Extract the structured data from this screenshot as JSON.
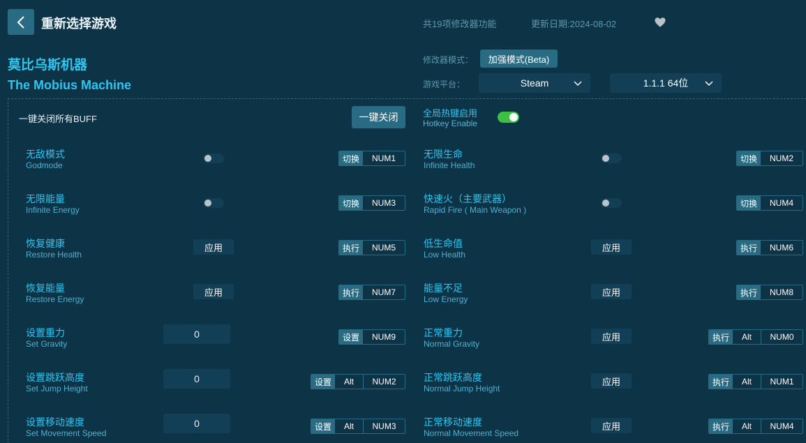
{
  "header": {
    "title": "重新选择游戏",
    "features_count": "共19项修改器功能",
    "update_date": "更新日期:2024-08-02"
  },
  "game": {
    "name_cn": "莫比乌斯机器",
    "name_en": "The Mobius Machine"
  },
  "meta": {
    "mode_label": "修改器模式：",
    "mode_value": "加强模式(Beta)",
    "platform_label": "游戏平台：",
    "platform_value": "Steam",
    "version_value": "1.1.1 64位"
  },
  "controls": {
    "all_buff_label": "一键关闭所有BUFF",
    "all_buff_button": "一键关闭",
    "hotkey_cn": "全局热键启用",
    "hotkey_en": "Hotkey Enable",
    "hotkey_enabled": true
  },
  "options": [
    {
      "cn": "无敌模式",
      "en": "Godmode",
      "type": "toggle",
      "on": false,
      "action": "切换",
      "keys": [
        "NUM1"
      ]
    },
    {
      "cn": "无限生命",
      "en": "Infinite Health",
      "type": "toggle",
      "on": false,
      "action": "切换",
      "keys": [
        "NUM2"
      ]
    },
    {
      "cn": "无限能量",
      "en": "Infinite Energy",
      "type": "toggle",
      "on": false,
      "action": "切换",
      "keys": [
        "NUM3"
      ]
    },
    {
      "cn": "快速火（主要武器）",
      "en": "Rapid Fire ( Main Weapon )",
      "type": "toggle",
      "on": false,
      "action": "切换",
      "keys": [
        "NUM4"
      ]
    },
    {
      "cn": "恢复健康",
      "en": "Restore Health",
      "type": "apply",
      "control": "应用",
      "action": "执行",
      "keys": [
        "NUM5"
      ]
    },
    {
      "cn": "低生命值",
      "en": "Low Health",
      "type": "apply",
      "control": "应用",
      "action": "执行",
      "keys": [
        "NUM6"
      ]
    },
    {
      "cn": "恢复能量",
      "en": "Restore Energy",
      "type": "apply",
      "control": "应用",
      "action": "执行",
      "keys": [
        "NUM7"
      ]
    },
    {
      "cn": "能量不足",
      "en": "Low Energy",
      "type": "apply",
      "control": "应用",
      "action": "执行",
      "keys": [
        "NUM8"
      ]
    },
    {
      "cn": "设置重力",
      "en": "Set Gravity",
      "type": "input",
      "value": "0",
      "action": "设置",
      "keys": [
        "NUM9"
      ]
    },
    {
      "cn": "正常重力",
      "en": "Normal Gravity",
      "type": "apply",
      "control": "应用",
      "action": "执行",
      "keys": [
        "Alt",
        "NUM0"
      ]
    },
    {
      "cn": "设置跳跃高度",
      "en": "Set Jump Height",
      "type": "input",
      "value": "0",
      "action": "设置",
      "keys": [
        "Alt",
        "NUM2"
      ]
    },
    {
      "cn": "正常跳跃高度",
      "en": "Normal Jump Height",
      "type": "apply",
      "control": "应用",
      "action": "执行",
      "keys": [
        "Alt",
        "NUM1"
      ]
    },
    {
      "cn": "设置移动速度",
      "en": "Set Movement Speed",
      "type": "input",
      "value": "0",
      "action": "设置",
      "keys": [
        "Alt",
        "NUM3"
      ]
    },
    {
      "cn": "正常移动速度",
      "en": "Normal Movement Speed",
      "type": "apply",
      "control": "应用",
      "action": "执行",
      "keys": [
        "Alt",
        "NUM4"
      ]
    }
  ]
}
